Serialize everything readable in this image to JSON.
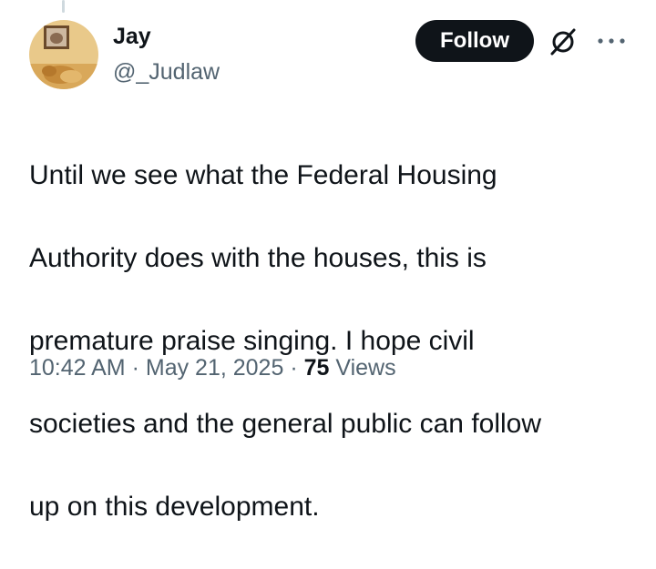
{
  "author": {
    "display_name": "Jay",
    "handle": "@_Judlaw"
  },
  "actions": {
    "follow_label": "Follow",
    "grok_icon": "grok-slash-circle-icon",
    "more_icon": "more-dots-icon"
  },
  "tweet": {
    "text_lines": [
      "Until we see what the Federal Housing",
      "Authority does with the houses, this is",
      "premature praise singing. I hope civil",
      "societies and the general public can follow",
      "up on this development."
    ]
  },
  "meta": {
    "time": "10:42 AM",
    "separator": "·",
    "date": "May 21, 2025",
    "views_count": "75",
    "views_label": "Views"
  },
  "colors": {
    "primary_text": "#0f1419",
    "secondary_text": "#536471",
    "follow_bg": "#0f1419"
  }
}
